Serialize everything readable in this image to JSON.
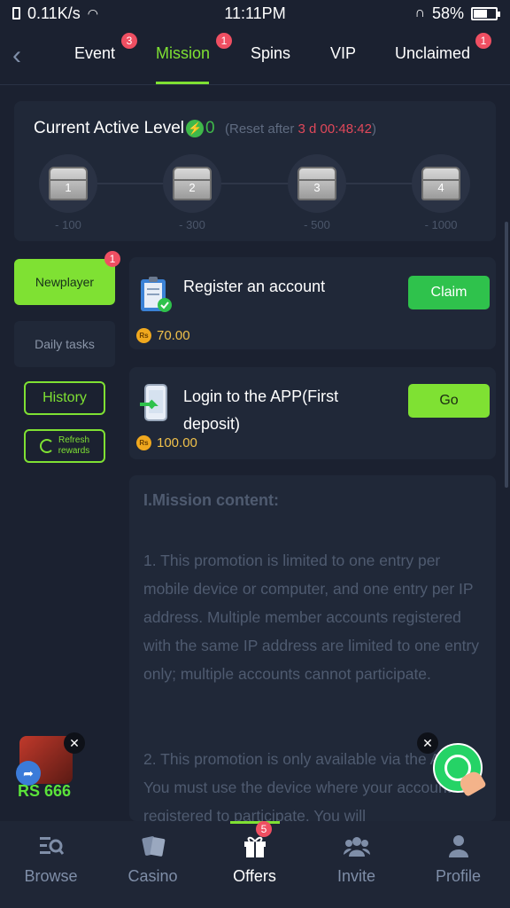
{
  "status_bar": {
    "speed": "0.11K/s",
    "time": "11:11PM",
    "battery": "58%"
  },
  "tabs": [
    {
      "label": "Event",
      "badge": "3"
    },
    {
      "label": "Mission",
      "badge": "1"
    },
    {
      "label": "Spins",
      "badge": ""
    },
    {
      "label": "VIP",
      "badge": ""
    },
    {
      "label": "Unclaimed",
      "badge": "1"
    }
  ],
  "level": {
    "title": "Current Active Level",
    "count": "0",
    "reset_prefix": "(Reset after ",
    "reset_time": "3 d 00:48:42",
    "reset_suffix": ")",
    "chests": [
      {
        "num": "1",
        "points": "- 100"
      },
      {
        "num": "2",
        "points": "- 300"
      },
      {
        "num": "3",
        "points": "- 500"
      },
      {
        "num": "4",
        "points": "- 1000"
      }
    ]
  },
  "side": {
    "newplayer": "Newplayer",
    "newplayer_badge": "1",
    "daily": "Daily tasks",
    "history": "History",
    "refresh_line1": "Refresh",
    "refresh_line2": "rewards"
  },
  "tasks": [
    {
      "title": "Register an account",
      "reward": "70.00",
      "button": "Claim"
    },
    {
      "title": "Login to the APP(First deposit)",
      "reward": "100.00",
      "button": "Go"
    }
  ],
  "currency_symbol": "Rs",
  "mission": {
    "heading": "I.Mission content:",
    "p1": "1. This promotion is limited to one entry per mobile device or computer, and one entry per IP address. Multiple member accounts registered with the same IP address are limited to one entry only; multiple accounts cannot participate.",
    "p2": "2. This promotion is only available via the APP. You must use the device where your account is registered to participate. You will"
  },
  "promo": {
    "text": "RS 666"
  },
  "bottom_nav": [
    {
      "label": "Browse",
      "icon": "browse-icon"
    },
    {
      "label": "Casino",
      "icon": "casino-icon"
    },
    {
      "label": "Offers",
      "icon": "gift-icon",
      "badge": "5"
    },
    {
      "label": "Invite",
      "icon": "invite-icon"
    },
    {
      "label": "Profile",
      "icon": "profile-icon"
    }
  ],
  "colors": {
    "accent": "#7fe133",
    "background": "#1b2130",
    "badge": "#ef4f62",
    "reset_time": "#e0485a",
    "reward": "#f0c14b"
  }
}
